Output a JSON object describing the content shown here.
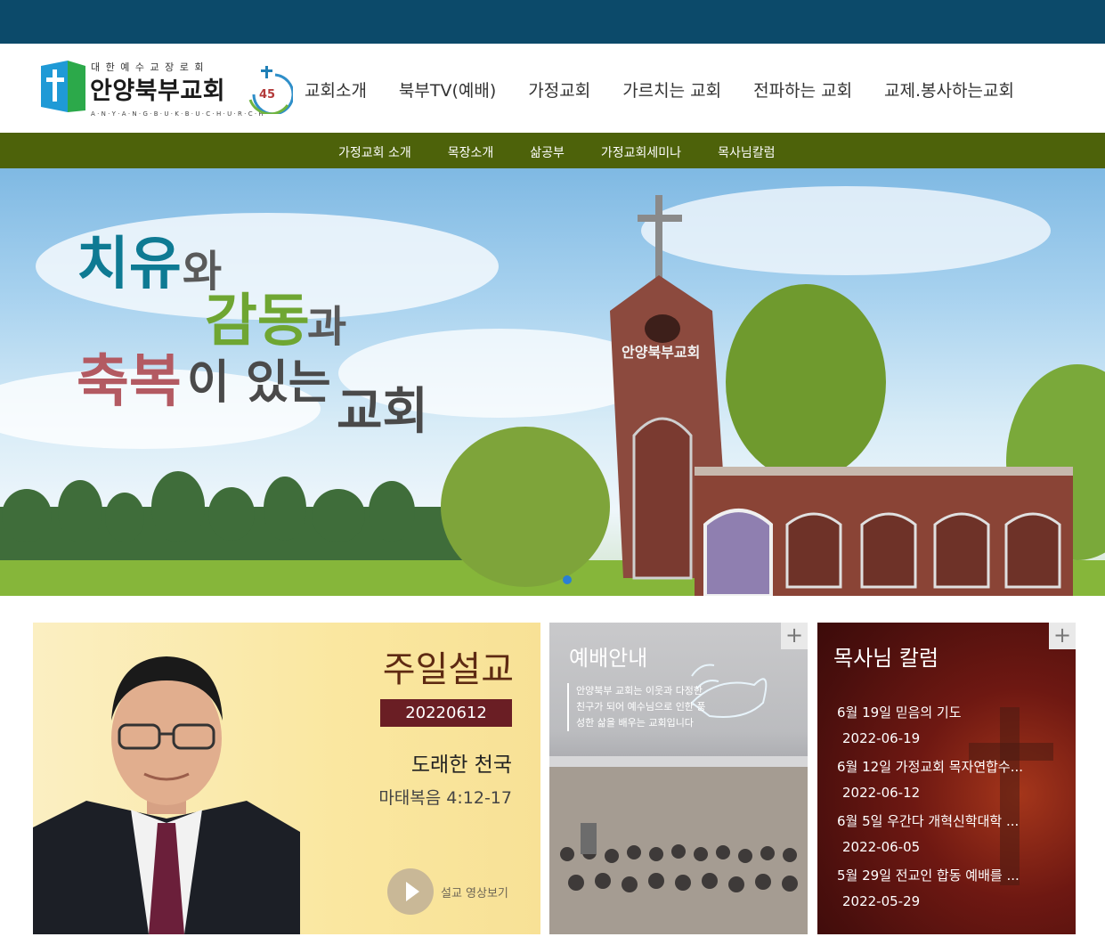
{
  "header": {
    "logo": {
      "top_text": "대한예수교장로회",
      "name": "안양북부교회",
      "english": "A·N·Y·A·N·G·B·U·K·B·U·C·H·U·R·C·H"
    },
    "nav": [
      "교회소개",
      "북부TV(예배)",
      "가정교회",
      "가르치는 교회",
      "전파하는 교회",
      "교제.봉사하는교회"
    ]
  },
  "subnav": [
    "가정교회 소개",
    "목장소개",
    "삶공부",
    "가정교회세미나",
    "목사님칼럼"
  ],
  "hero": {
    "line1_main": "치유",
    "line1_rest": "와",
    "line2_main": "감동",
    "line2_rest": "과",
    "line3_main": "축복",
    "line3_mid": "이 있는",
    "line3_end": "교회",
    "church_sign": "안양북부교회",
    "active_slide": 1
  },
  "sermon": {
    "title": "주일설교",
    "date": "20220612",
    "subtitle": "도래한 천국",
    "verse": "마태복음 4:12-17",
    "video_label": "설교 영상보기"
  },
  "worship": {
    "title": "예배안내",
    "text": "안양북부 교회는 이웃과 다정한 친구가 되어 예수님으로 인한 풍성한 삶을 배우는 교회입니다",
    "more": "+"
  },
  "column": {
    "title": "목사님 칼럼",
    "more": "+",
    "items": [
      {
        "title": "6월 19일 믿음의 기도",
        "date": "2022-06-19"
      },
      {
        "title": "6월 12일 가정교회 목자연합수...",
        "date": "2022-06-12"
      },
      {
        "title": "6월 5일 우간다 개혁신학대학 ...",
        "date": "2022-06-05"
      },
      {
        "title": "5월 29일 전교인 합동 예배를 ...",
        "date": "2022-05-29"
      }
    ]
  },
  "colors": {
    "topbar": "#0c4a6a",
    "subnav": "#4d620a",
    "sermon_date_bg": "#6a1e24",
    "column_bg": "#6e1812"
  }
}
